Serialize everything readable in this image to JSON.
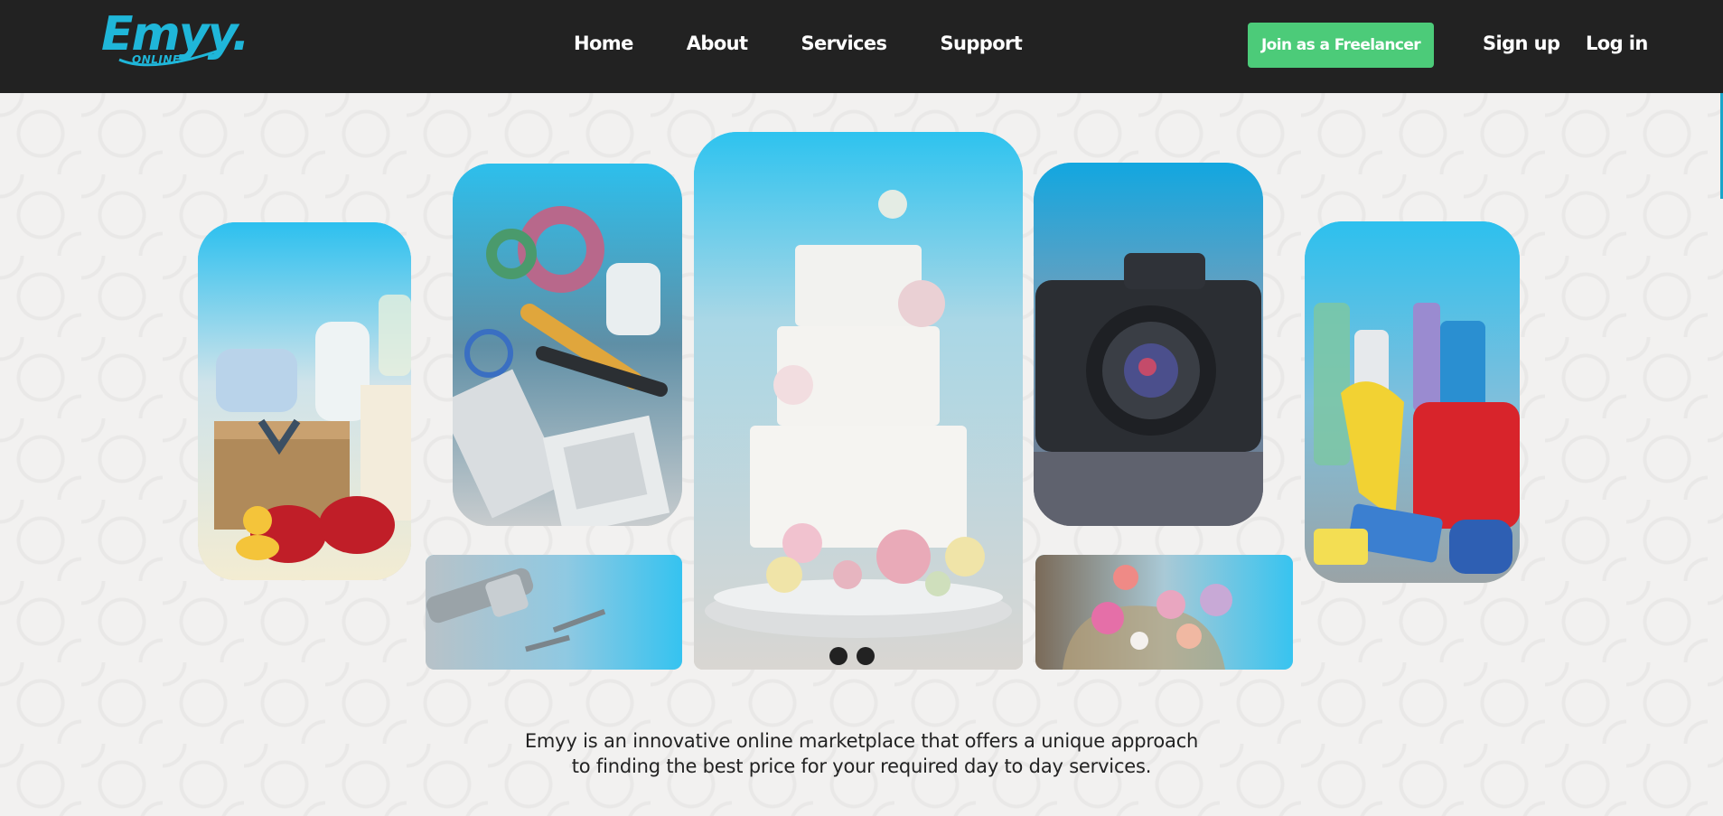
{
  "brand": {
    "logo_text": "Emyy.",
    "logo_sub": "ONLINE",
    "color": "#1fb6d9"
  },
  "nav": {
    "items": [
      {
        "label": "Home"
      },
      {
        "label": "About"
      },
      {
        "label": "Services"
      },
      {
        "label": "Support"
      }
    ]
  },
  "header_actions": {
    "freelancer_label": "Join as a Freelancer",
    "freelancer_color": "#4ccb79",
    "signup_label": "Sign up",
    "login_label": "Log in"
  },
  "gallery": {
    "tiles": [
      {
        "name": "baby-products-image"
      },
      {
        "name": "electrical-tools-image"
      },
      {
        "name": "wedding-cake-image"
      },
      {
        "name": "camera-image"
      },
      {
        "name": "cleaning-supplies-image"
      },
      {
        "name": "plumbing-pipe-image"
      },
      {
        "name": "flower-basket-image"
      }
    ],
    "overlay_color": "#33c3ee"
  },
  "hero": {
    "tagline_line1": "Emyy is an innovative online marketplace that offers a unique approach",
    "tagline_line2": "to finding the best price for your required day to day services."
  },
  "colors": {
    "header_bg": "#222222",
    "page_bg": "#f1f0ef",
    "text": "#222222"
  }
}
